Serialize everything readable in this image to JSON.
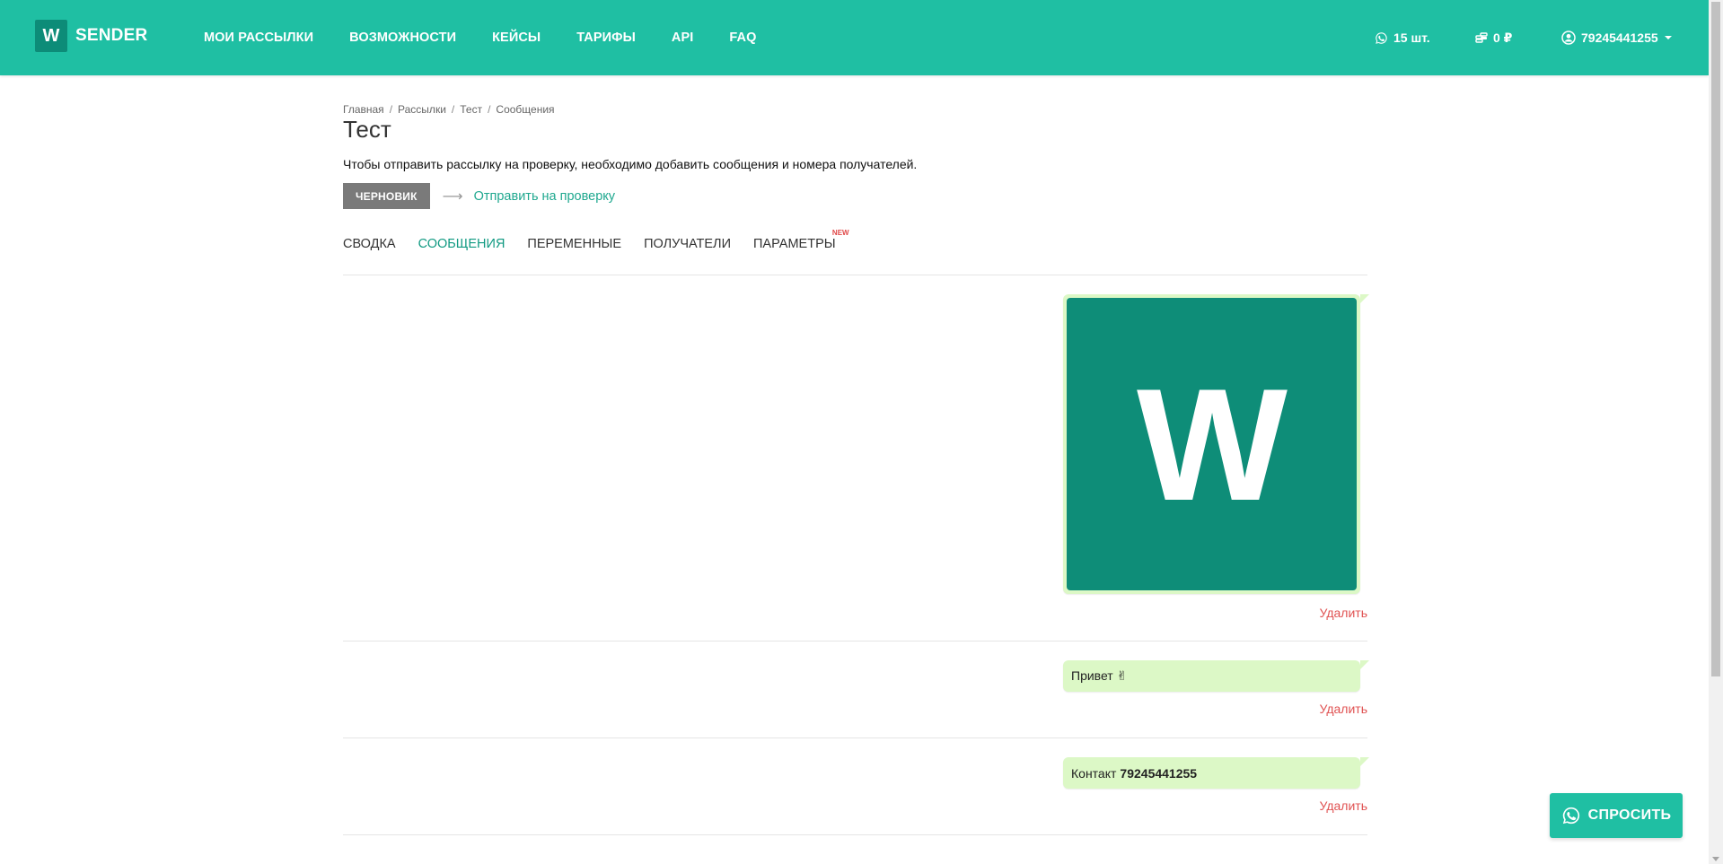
{
  "header": {
    "logo_mark": "W",
    "logo_text": "SENDER",
    "nav": [
      "МОИ РАССЫЛКИ",
      "ВОЗМОЖНОСТИ",
      "КЕЙСЫ",
      "ТАРИФЫ",
      "API",
      "FAQ"
    ],
    "whatsapp_count": "15 шт.",
    "balance": "0 ₽",
    "account": "79245441255",
    "icons": {
      "count": "whatsapp-icon",
      "balance": "coins-icon",
      "account": "user-circle-icon"
    }
  },
  "breadcrumb": [
    "Главная",
    "Рассылки",
    "Тест",
    "Сообщения"
  ],
  "title": "Тест",
  "info_text": "Чтобы отправить рассылку на проверку, необходимо добавить сообщения и номера получателей.",
  "status": {
    "badge": "ЧЕРНОВИК",
    "send_link": "Отправить на проверку"
  },
  "tabs": [
    {
      "label": "СВОДКА",
      "active": false
    },
    {
      "label": "СООБЩЕНИЯ",
      "active": true
    },
    {
      "label": "ПЕРЕМЕННЫЕ",
      "active": false
    },
    {
      "label": "ПОЛУЧАТЕЛИ",
      "active": false
    },
    {
      "label": "ПАРАМЕТРЫ",
      "active": false,
      "badge": "NEW"
    }
  ],
  "messages": [
    {
      "type": "image",
      "image_letter": "W",
      "delete_label": "Удалить"
    },
    {
      "type": "text",
      "text": "Привет ✌",
      "delete_label": "Удалить"
    },
    {
      "type": "contact",
      "label": "Контакт",
      "value": "79245441255",
      "delete_label": "Удалить"
    }
  ],
  "ask_button": "СПРОСИТЬ",
  "colors": {
    "brand": "#1fbfa3",
    "brand_dark": "#0d8c78",
    "bubble": "#dcf8c6",
    "delete": "#e05252",
    "draft_badge": "#7a7a7a"
  }
}
